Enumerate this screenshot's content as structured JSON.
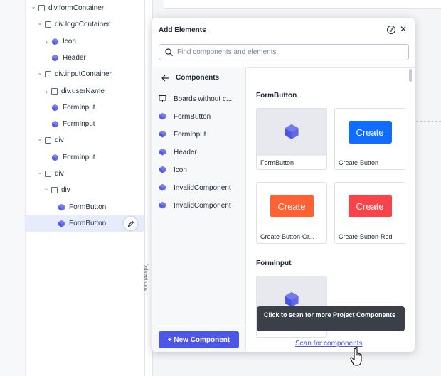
{
  "tree": {
    "items": [
      {
        "label": "div.formContainer",
        "indent": 0,
        "chevron": "v",
        "icon": "box"
      },
      {
        "label": "div.logoContainer",
        "indent": 1,
        "chevron": "v",
        "icon": "box"
      },
      {
        "label": "Icon",
        "indent": 2,
        "chevron": ">",
        "icon": "cube"
      },
      {
        "label": "Header",
        "indent": 2,
        "chevron": "",
        "icon": "cube"
      },
      {
        "label": "div.inputContainer",
        "indent": 1,
        "chevron": "v",
        "icon": "box"
      },
      {
        "label": "div.userName",
        "indent": 2,
        "chevron": ">",
        "icon": "box"
      },
      {
        "label": "FormInput",
        "indent": 2,
        "chevron": "",
        "icon": "cube"
      },
      {
        "label": "FormInput",
        "indent": 2,
        "chevron": "",
        "icon": "cube"
      },
      {
        "label": "div",
        "indent": 1,
        "chevron": "v",
        "icon": "box"
      },
      {
        "label": "FormInput",
        "indent": 2,
        "chevron": "",
        "icon": "cube"
      },
      {
        "label": "div",
        "indent": 1,
        "chevron": "v",
        "icon": "box"
      },
      {
        "label": "div",
        "indent": 2,
        "chevron": "v",
        "icon": "box"
      },
      {
        "label": "FormButton",
        "indent": 3,
        "chevron": "",
        "icon": "cube"
      },
      {
        "label": "FormButton",
        "indent": 3,
        "chevron": "",
        "icon": "cube",
        "selected": true
      }
    ]
  },
  "canvas": {
    "vertical_label": "auto (440px)"
  },
  "panel": {
    "title": "Add Elements",
    "help_glyph": "?",
    "close_glyph": "✕",
    "search_placeholder": "Find components and elements",
    "list_header": "Components",
    "list_items": [
      {
        "label": "Boards without c...",
        "icon": "board"
      },
      {
        "label": "FormButton",
        "icon": "cube"
      },
      {
        "label": "FormInput",
        "icon": "cube"
      },
      {
        "label": "Header",
        "icon": "cube"
      },
      {
        "label": "Icon",
        "icon": "cube"
      },
      {
        "label": "InvalidComponent",
        "icon": "cube"
      },
      {
        "label": "InvalidComponent",
        "icon": "cube"
      }
    ],
    "new_component_label": "+ New Component",
    "sections": [
      {
        "title": "FormButton",
        "cards": [
          {
            "name": "FormButton",
            "preview": "cube"
          },
          {
            "name": "Create-Button",
            "preview": "button",
            "button_text": "Create",
            "color": "#116dff"
          },
          {
            "name": "Create-Button-Or...",
            "preview": "button",
            "button_text": "Create",
            "color": "#fe6133"
          },
          {
            "name": "Create-Button-Red",
            "preview": "button",
            "button_text": "Create",
            "color": "#f5454a"
          }
        ]
      },
      {
        "title": "FormInput",
        "cards": [
          {
            "name": "",
            "preview": "cube"
          }
        ]
      }
    ],
    "tooltip": "Click to scan for more Project Components",
    "scan_link": "Scan for components"
  },
  "colors": {
    "accent": "#4d57e6",
    "cube": "#4d57e6",
    "selected_row": "#e7ecfd"
  }
}
